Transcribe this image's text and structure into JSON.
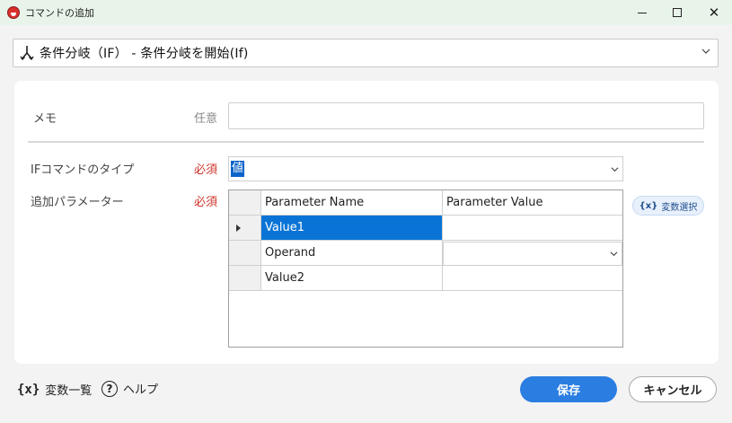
{
  "window": {
    "title": "コマンドの追加"
  },
  "command": {
    "label": "条件分岐（IF） - 条件分岐を開始(If)"
  },
  "form": {
    "memo_label": "メモ",
    "memo_optional": "任意",
    "memo_value": "",
    "if_type_label": "IFコマンドのタイプ",
    "if_type_required": "必須",
    "if_type_value": "値",
    "params_label": "追加パラメーター",
    "params_required": "必須"
  },
  "grid": {
    "columns": [
      "Parameter Name",
      "Parameter Value"
    ],
    "rows": [
      {
        "name": "Value1",
        "value": ""
      },
      {
        "name": "Operand",
        "value": ""
      },
      {
        "name": "Value2",
        "value": ""
      }
    ]
  },
  "var_select": {
    "glyph": "{x}",
    "label": "変数選択"
  },
  "footer": {
    "var_list_glyph": "{x}",
    "var_list_label": "変数一覧",
    "help_glyph": "?",
    "help_label": "ヘルプ",
    "save_label": "保存",
    "cancel_label": "キャンセル"
  },
  "colors": {
    "accent": "#2a7de1",
    "required": "#d0342c",
    "selection": "#0a74d6",
    "titlebar": "#e8f4ea"
  }
}
